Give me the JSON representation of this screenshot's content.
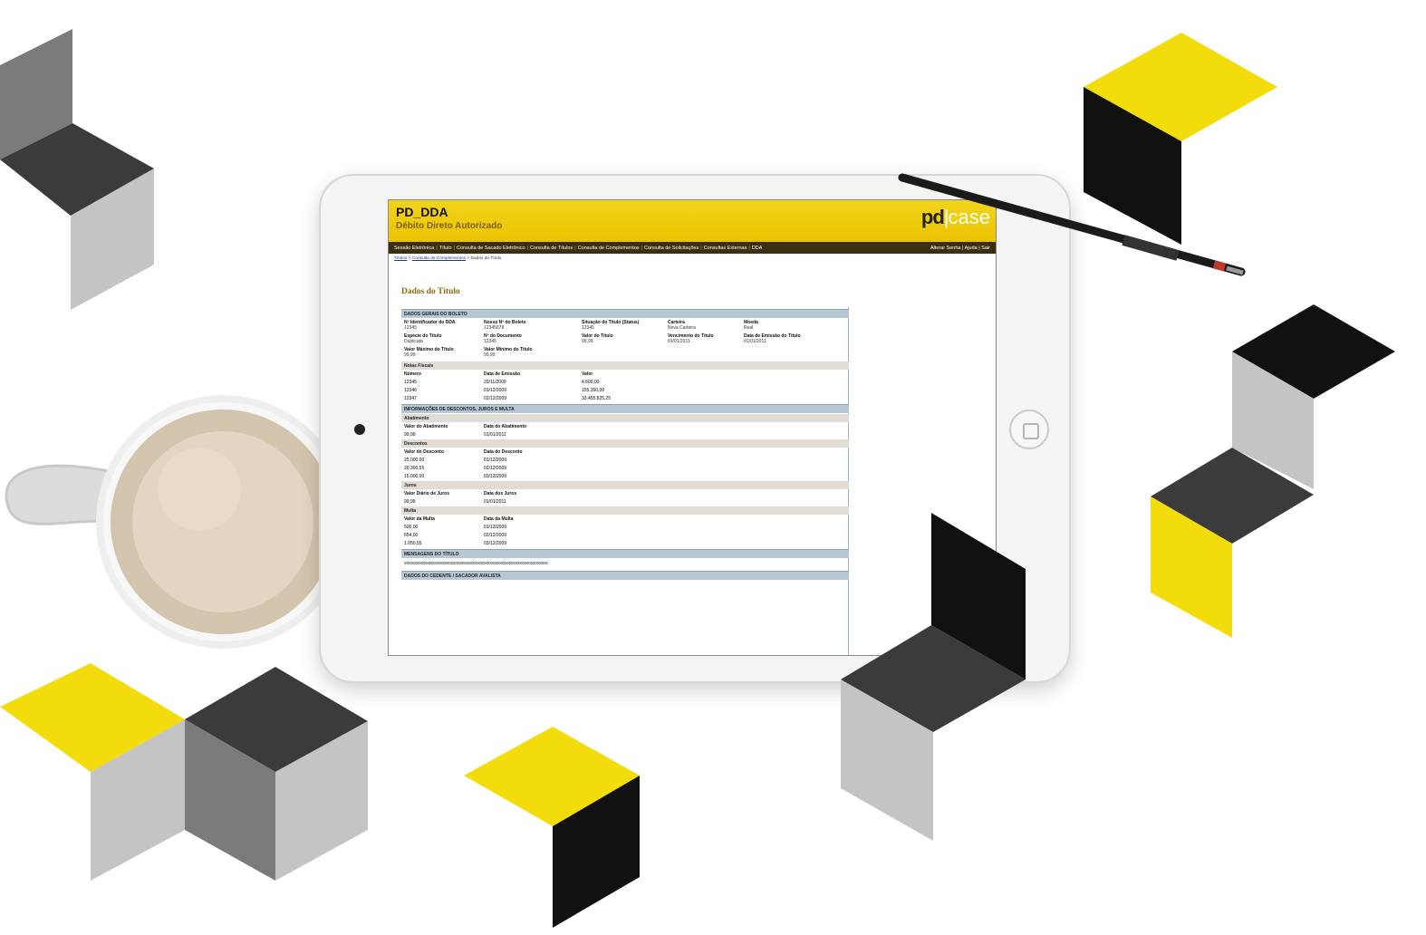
{
  "app": {
    "title": "PD_DDA",
    "subtitle": "Débito Direto Autorizado",
    "brand_pd": "pd",
    "brand_sep": "|",
    "brand_case": "case"
  },
  "menu": {
    "items": [
      "Sessão Eletrônica",
      "Título",
      "Consulta de Sacado Eletrônico",
      "Consulta de Títulos",
      "Consulta de Complementos",
      "Consulta de Solicitações",
      "Consultas Externas",
      "DDA"
    ],
    "right": "Alterar Senha | Ajuda | Sair"
  },
  "breadcrumb": {
    "home": "Títulos",
    "middle": "Consulta de Complementos",
    "current": "Dados do Título"
  },
  "page_title": "Dados do Título",
  "general": {
    "section": "DADOS GERAIS DO BOLETO",
    "fields": [
      {
        "label": "Nº Identificador do DDA",
        "value": "12345"
      },
      {
        "label": "Nosso Nº do Boleto",
        "value": "12345678"
      },
      {
        "label": "Situação do Título (Status)",
        "value": "12345"
      },
      {
        "label": "Carteira",
        "value": "Nova Carteira"
      },
      {
        "label": "Moeda",
        "value": "Real"
      },
      {
        "label": "Espécie do Título",
        "value": "Duplicata"
      },
      {
        "label": "Nº do Documento",
        "value": "12345"
      },
      {
        "label": "Valor do Título",
        "value": "99,99"
      },
      {
        "label": "Vencimento do Título",
        "value": "01/01/2011"
      },
      {
        "label": "Data de Emissão do Título",
        "value": "01/01/2011"
      },
      {
        "label": "Valor Máximo do Título",
        "value": "99,99"
      },
      {
        "label": "Valor Mínimo do Título",
        "value": "99,99"
      }
    ]
  },
  "notas": {
    "title": "Notas Fiscais",
    "headers": [
      "Número",
      "Data de Emissão",
      "Valor"
    ],
    "rows": [
      [
        "12345",
        "20/11/2009",
        "4.500,00"
      ],
      [
        "12346",
        "01/12/2009",
        "155.350,00"
      ],
      [
        "12347",
        "02/12/2009",
        "33.455.825,25"
      ]
    ]
  },
  "discounts": {
    "section": "INFORMAÇÕES DE DESCONTOS, JUROS E MULTA",
    "abatimento": {
      "title": "Abatimento",
      "headers": [
        "Valor do Abatimento",
        "Data do Abatimento"
      ],
      "row": [
        "99,99",
        "01/01/2011"
      ]
    },
    "descontos": {
      "title": "Descontos",
      "headers": [
        "Valor do Desconto",
        "Data do Desconto"
      ],
      "rows": [
        [
          "25.000,00",
          "01/12/2009"
        ],
        [
          "20.300,55",
          "02/12/2009"
        ],
        [
          "15.000,00",
          "03/12/2009"
        ]
      ]
    },
    "juros": {
      "title": "Juros",
      "headers": [
        "Valor Diário de Juros",
        "Data dos Juros"
      ],
      "row": [
        "99,99",
        "01/01/2011"
      ]
    },
    "multa": {
      "title": "Multa",
      "headers": [
        "Valor da Multa",
        "Data da Multa"
      ],
      "rows": [
        [
          "500,00",
          "01/12/2009"
        ],
        [
          "654,00",
          "02/12/2009"
        ],
        [
          "1.050,55",
          "03/12/2009"
        ]
      ]
    }
  },
  "messages": {
    "section": "MENSAGENS DO TÍTULO",
    "text": "xxxxxxxxxxxxxxxxxxxxxxxxxxxxxxxxxxxxxxxxxxxxxxxxxxxxxxxxxxxxxxxxxxxxxxxx",
    "next_section": "DADOS DO CEDENTE / SACADOR AVALISTA"
  },
  "colors": {
    "yellow": "#f2d500",
    "dark": "#3b3b3b",
    "black": "#111111",
    "gray": "#c4c4c4",
    "mid": "#7a7a7a"
  }
}
